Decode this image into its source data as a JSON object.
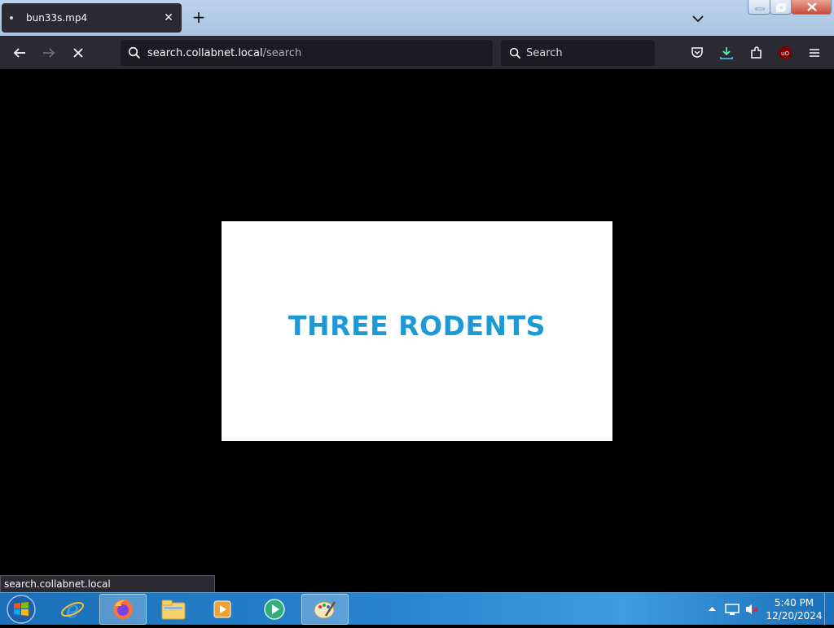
{
  "browser": {
    "tab": {
      "title": "bun33s.mp4",
      "close_glyph": "✕"
    },
    "new_tab_glyph": "+",
    "address": {
      "host": "search.collabnet.local",
      "path": "/search"
    },
    "search": {
      "placeholder": "Search"
    },
    "status_url": "search.collabnet.local"
  },
  "video": {
    "title_text": "THREE RODENTS",
    "title_color": "#1d9ad6"
  },
  "taskbar": {
    "apps": [
      "internet-explorer-icon",
      "firefox-icon",
      "file-explorer-icon",
      "media-player-icon",
      "media-center-icon",
      "paint-icon"
    ],
    "time": "5:40 PM",
    "date": "12/20/2024"
  }
}
